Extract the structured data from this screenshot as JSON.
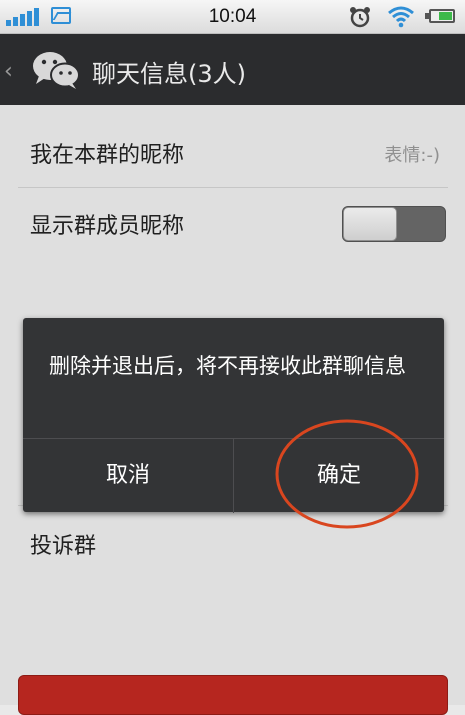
{
  "status_bar": {
    "time": "10:04",
    "icons": [
      "signal-icon",
      "gallery-icon",
      "alarm-icon",
      "wifi-icon",
      "battery-icon"
    ],
    "accent_color": "#2f8fd6"
  },
  "title_bar": {
    "back_icon": "‹",
    "title": "聊天信息(3人)"
  },
  "settings": {
    "nickname_label": "我在本群的昵称",
    "nickname_value": "表情:-)",
    "show_member_nickname_label": "显示群成员昵称",
    "show_member_nickname_on": false,
    "report_label": "投诉群"
  },
  "dialog": {
    "message": "删除并退出后，将不再接收此群聊信息",
    "cancel_label": "取消",
    "confirm_label": "确定"
  },
  "colors": {
    "title_bar_bg": "#2b2c2e",
    "dialog_bg": "#333436",
    "annotation": "#d9461f",
    "delete_button": "#b6261f"
  }
}
